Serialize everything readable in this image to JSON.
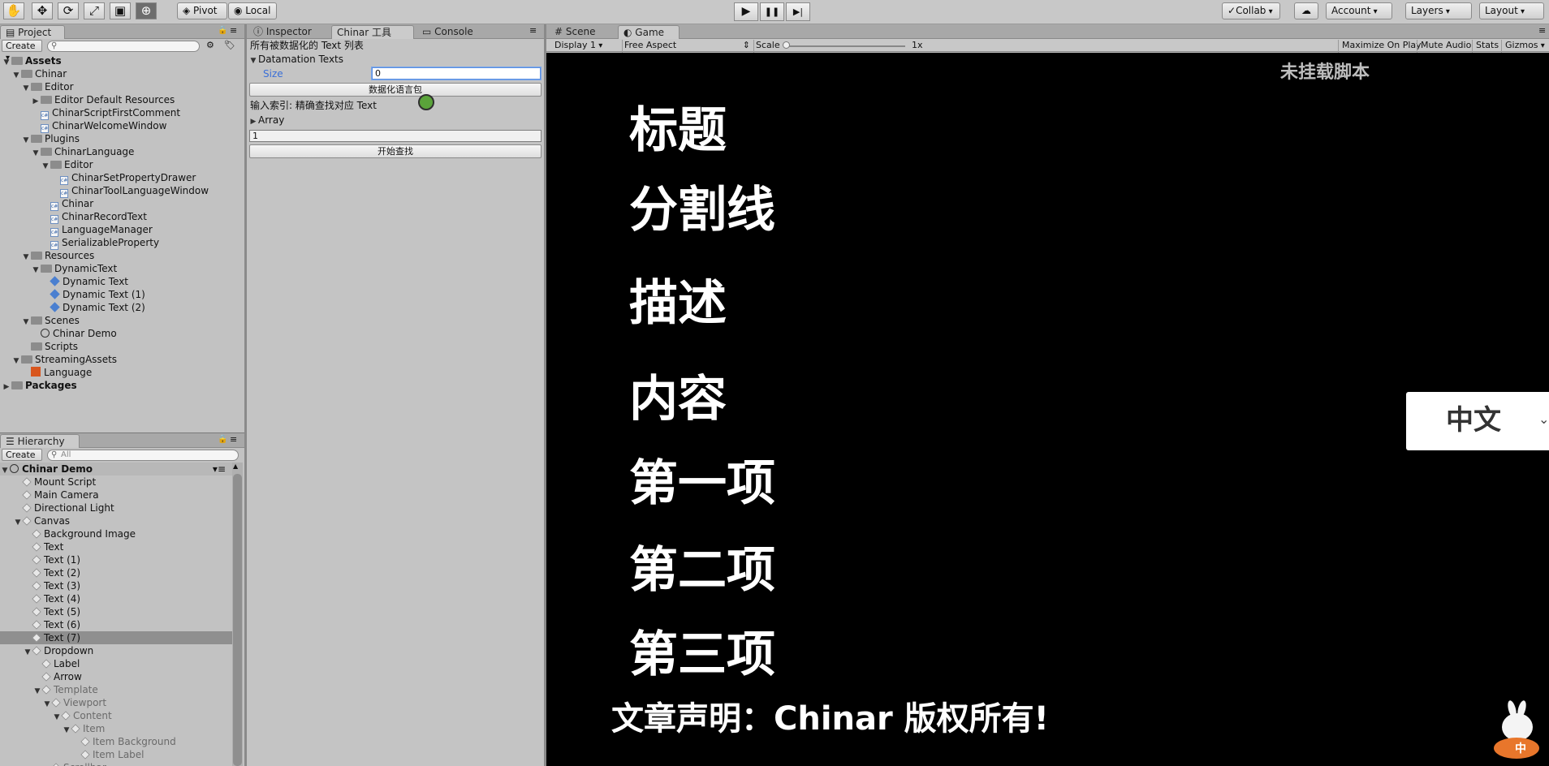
{
  "toolbar": {
    "tools": [
      "hand-tool-icon",
      "move-tool-icon",
      "rotate-tool-icon",
      "scale-tool-icon",
      "rect-tool-icon",
      "transform-tool-icon"
    ],
    "pivot": "Pivot",
    "local": "Local",
    "play": "▶",
    "pause": "❚❚",
    "step": "▶|",
    "collab": "Collab",
    "account": "Account",
    "layers": "Layers",
    "layout": "Layout"
  },
  "project": {
    "tab": "Project",
    "create": "Create",
    "items": [
      {
        "label": "Assets",
        "depth": 0,
        "open": true,
        "kind": "folder",
        "bold": true
      },
      {
        "label": "Chinar",
        "depth": 1,
        "open": true,
        "kind": "folder"
      },
      {
        "label": "Editor",
        "depth": 2,
        "open": true,
        "kind": "folder"
      },
      {
        "label": "Editor Default Resources",
        "depth": 3,
        "open": false,
        "kind": "folder"
      },
      {
        "label": "ChinarScriptFirstComment",
        "depth": 3,
        "kind": "script"
      },
      {
        "label": "ChinarWelcomeWindow",
        "depth": 3,
        "kind": "script"
      },
      {
        "label": "Plugins",
        "depth": 2,
        "open": true,
        "kind": "folder"
      },
      {
        "label": "ChinarLanguage",
        "depth": 3,
        "open": true,
        "kind": "folder"
      },
      {
        "label": "Editor",
        "depth": 4,
        "open": true,
        "kind": "folder"
      },
      {
        "label": "ChinarSetPropertyDrawer",
        "depth": 5,
        "kind": "script"
      },
      {
        "label": "ChinarToolLanguageWindow",
        "depth": 5,
        "kind": "script"
      },
      {
        "label": "Chinar",
        "depth": 4,
        "kind": "script"
      },
      {
        "label": "ChinarRecordText",
        "depth": 4,
        "kind": "script"
      },
      {
        "label": "LanguageManager",
        "depth": 4,
        "kind": "script"
      },
      {
        "label": "SerializableProperty",
        "depth": 4,
        "kind": "script"
      },
      {
        "label": "Resources",
        "depth": 2,
        "open": true,
        "kind": "folder"
      },
      {
        "label": "DynamicText",
        "depth": 3,
        "open": true,
        "kind": "folder"
      },
      {
        "label": "Dynamic Text",
        "depth": 4,
        "kind": "prefab"
      },
      {
        "label": "Dynamic Text (1)",
        "depth": 4,
        "kind": "prefab"
      },
      {
        "label": "Dynamic Text (2)",
        "depth": 4,
        "kind": "prefab"
      },
      {
        "label": "Scenes",
        "depth": 2,
        "open": true,
        "kind": "folder"
      },
      {
        "label": "Chinar Demo",
        "depth": 3,
        "kind": "scene"
      },
      {
        "label": "Scripts",
        "depth": 2,
        "kind": "folder"
      },
      {
        "label": "StreamingAssets",
        "depth": 1,
        "open": true,
        "kind": "folder"
      },
      {
        "label": "Language",
        "depth": 2,
        "kind": "lang"
      },
      {
        "label": "Packages",
        "depth": 0,
        "open": false,
        "kind": "folder",
        "bold": true
      }
    ]
  },
  "hierarchy": {
    "tab": "Hierarchy",
    "create": "Create",
    "search_placeholder": "All",
    "scene": "Chinar Demo",
    "items": [
      {
        "label": "Mount Script",
        "depth": 1
      },
      {
        "label": "Main Camera",
        "depth": 1
      },
      {
        "label": "Directional Light",
        "depth": 1
      },
      {
        "label": "Canvas",
        "depth": 1,
        "open": true
      },
      {
        "label": "Background Image",
        "depth": 2
      },
      {
        "label": "Text",
        "depth": 2
      },
      {
        "label": "Text (1)",
        "depth": 2
      },
      {
        "label": "Text (2)",
        "depth": 2
      },
      {
        "label": "Text (3)",
        "depth": 2
      },
      {
        "label": "Text (4)",
        "depth": 2
      },
      {
        "label": "Text (5)",
        "depth": 2
      },
      {
        "label": "Text (6)",
        "depth": 2
      },
      {
        "label": "Text (7)",
        "depth": 2,
        "selected": true
      },
      {
        "label": "Dropdown",
        "depth": 2,
        "open": true
      },
      {
        "label": "Label",
        "depth": 3
      },
      {
        "label": "Arrow",
        "depth": 3
      },
      {
        "label": "Template",
        "depth": 3,
        "open": true,
        "dim": true
      },
      {
        "label": "Viewport",
        "depth": 4,
        "open": true,
        "dim": true
      },
      {
        "label": "Content",
        "depth": 5,
        "open": true,
        "dim": true
      },
      {
        "label": "Item",
        "depth": 6,
        "open": true,
        "dim": true
      },
      {
        "label": "Item Background",
        "depth": 7,
        "dim": true
      },
      {
        "label": "Item Label",
        "depth": 7,
        "dim": true
      },
      {
        "label": "Scrollbar",
        "depth": 4,
        "open": false,
        "dim": true
      }
    ]
  },
  "inspector": {
    "tabs": [
      "Inspector",
      "Chinar 工具",
      "Console"
    ],
    "heading": "所有被数据化的 Text 列表",
    "datamation_label": "Datamation Texts",
    "size_label": "Size",
    "size_value": "0",
    "button_datafy": "数据化语言包",
    "search_hint": "输入索引: 精确查找对应 Text",
    "array_label": "Array",
    "index_value": "1",
    "button_find": "开始查找"
  },
  "game": {
    "tabs": [
      "Scene",
      "Game"
    ],
    "display": "Display 1",
    "aspect": "Free Aspect",
    "scale_label": "Scale",
    "scale_value": "1x",
    "maximize": "Maximize On Play",
    "mute": "Mute Audio",
    "stats": "Stats",
    "gizmos": "Gizmos",
    "notice": "未挂载脚本",
    "texts": [
      "标题",
      "分割线",
      "描述",
      "内容",
      "第一项",
      "第二项",
      "第三项"
    ],
    "footer": "文章声明：Chinar 版权所有!",
    "dropdown_value": "中文",
    "mascot_badge": "中"
  }
}
